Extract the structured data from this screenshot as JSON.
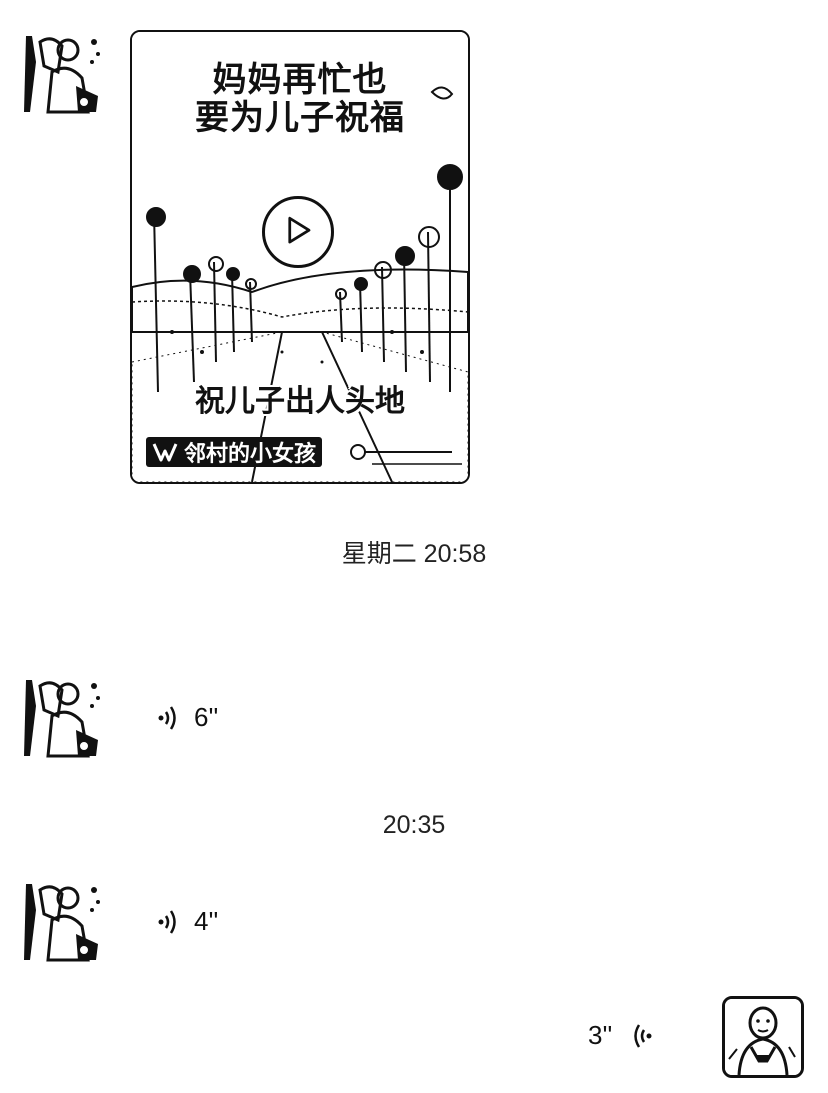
{
  "messages": [
    {
      "type": "video",
      "sender": "contact",
      "title_line1": "妈妈再忙也",
      "title_line2": "要为儿子祝福",
      "caption": "祝儿子出人头地",
      "author": "邻村的小女孩"
    },
    {
      "type": "timestamp",
      "text": "星期二 20:58"
    },
    {
      "type": "voice",
      "sender": "contact",
      "duration": "6''"
    },
    {
      "type": "timestamp",
      "text": "20:35"
    },
    {
      "type": "voice",
      "sender": "contact",
      "duration": "4''"
    },
    {
      "type": "voice",
      "sender": "self",
      "duration": "3''"
    }
  ],
  "icons": {
    "play": "play-icon",
    "voice_in": "voice-wave-icon",
    "voice_out": "voice-wave-icon",
    "video_channel": "channels-logo-icon",
    "verified": "verified-icon"
  },
  "colors": {
    "background": "#ffffff",
    "text": "#111111"
  }
}
